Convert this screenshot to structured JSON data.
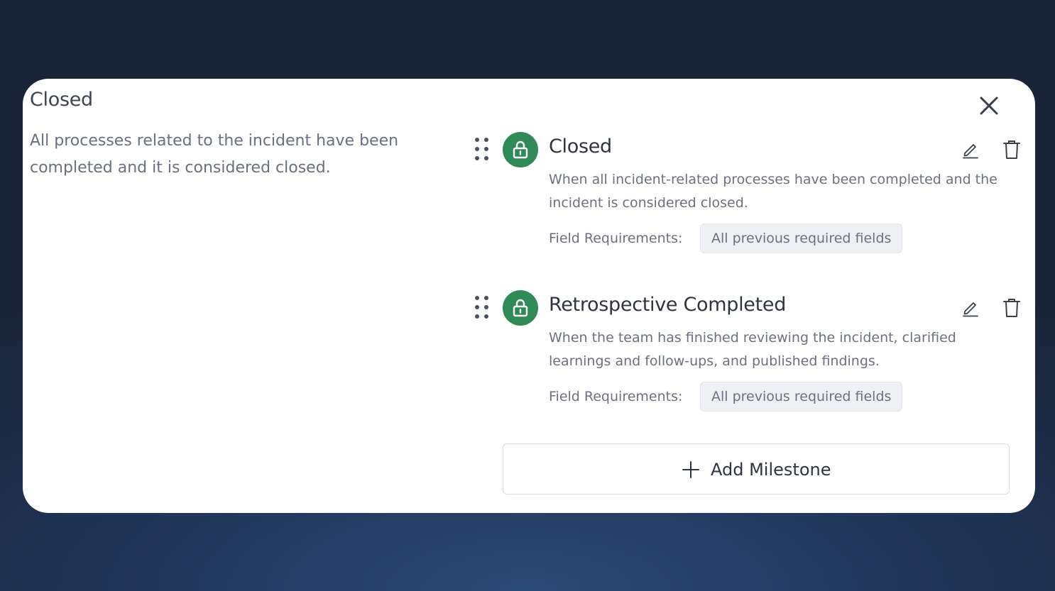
{
  "dialog": {
    "title": "Closed",
    "description": "All processes related to the incident have been completed and it is considered closed."
  },
  "milestones": [
    {
      "title": "Closed",
      "description": "When all incident-related processes have been completed and the incident is considered closed.",
      "requirements_label": "Field Requirements:",
      "requirements_value": "All previous required fields",
      "icon": "lock-icon"
    },
    {
      "title": "Retrospective Completed",
      "description": "When the team has finished reviewing the incident, clarified learnings and follow-ups, and published findings.",
      "requirements_label": "Field Requirements:",
      "requirements_value": "All previous required fields",
      "icon": "lock-icon"
    }
  ],
  "actions": {
    "add_milestone_label": "Add Milestone"
  },
  "colors": {
    "badge_green": "#2f8a58",
    "card_background": "#ffffff",
    "text_primary": "#2f3441",
    "text_secondary": "#6b7180"
  },
  "icons": {
    "close": "close-icon",
    "drag": "drag-handle-icon",
    "edit": "pencil-icon",
    "delete": "trash-icon",
    "add": "plus-icon"
  }
}
